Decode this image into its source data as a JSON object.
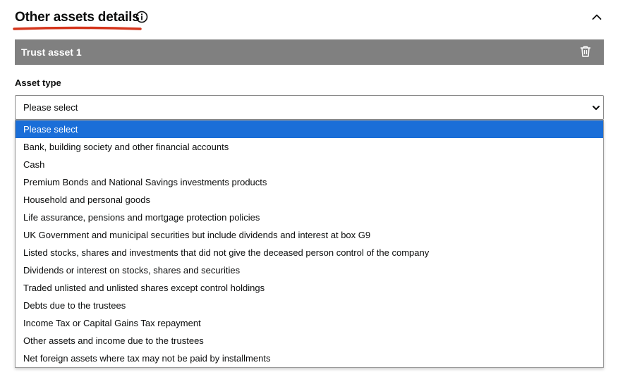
{
  "section": {
    "title": "Other assets details"
  },
  "asset": {
    "title": "Trust asset 1"
  },
  "field": {
    "label": "Asset type",
    "selected_value": "Please select"
  },
  "options": [
    "Please select",
    "Bank, building society and other financial accounts",
    "Cash",
    "Premium Bonds and National Savings investments products",
    "Household and personal goods",
    "Life assurance, pensions and mortgage protection policies",
    "UK Government and municipal securities but include dividends and interest at box G9",
    "Listed stocks, shares and investments that did not give the deceased person control of the company",
    "Dividends or interest on stocks, shares and securities",
    "Traded unlisted and unlisted shares except control holdings",
    "Debts due to the trustees",
    "Income Tax or Capital Gains Tax repayment",
    "Other assets and income due to the trustees",
    "Net foreign assets where tax may not be paid by installments"
  ],
  "selected_index": 0,
  "icons": {
    "info": "info-icon",
    "collapse": "chevron-up-icon",
    "delete": "trash-icon",
    "dropdown": "chevron-down-icon"
  },
  "colors": {
    "underline": "#d4351c",
    "asset_bar": "#808080",
    "selected_option": "#1a6ed8"
  }
}
